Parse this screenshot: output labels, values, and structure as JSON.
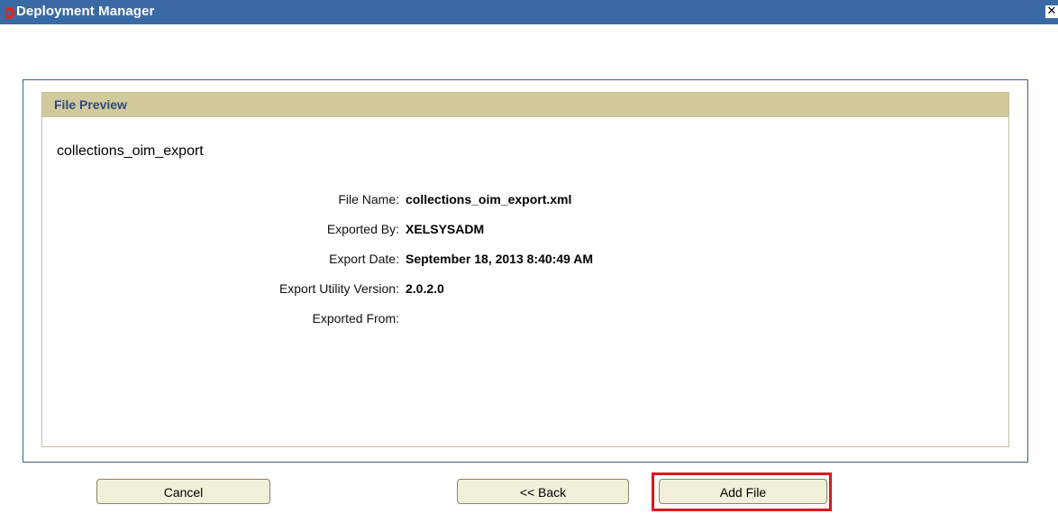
{
  "window": {
    "title": "Deployment Manager",
    "close_glyph": "✕"
  },
  "panel": {
    "header": "File Preview",
    "file_title": "collections_oim_export",
    "details": [
      {
        "label": "File Name:",
        "value": "collections_oim_export.xml"
      },
      {
        "label": "Exported By:",
        "value": "XELSYSADM"
      },
      {
        "label": "Export Date:",
        "value": "September 18, 2013 8:40:49 AM"
      },
      {
        "label": "Export Utility Version:",
        "value": "2.0.2.0"
      },
      {
        "label": "Exported From:",
        "value": ""
      }
    ]
  },
  "buttons": {
    "cancel": "Cancel",
    "back": "<< Back",
    "add_file": "Add File"
  },
  "colors": {
    "titlebar": "#3a6aa5",
    "panel_header": "#d2ca9d",
    "panel_header_text": "#2f4a7c",
    "highlight": "#e0141e"
  }
}
